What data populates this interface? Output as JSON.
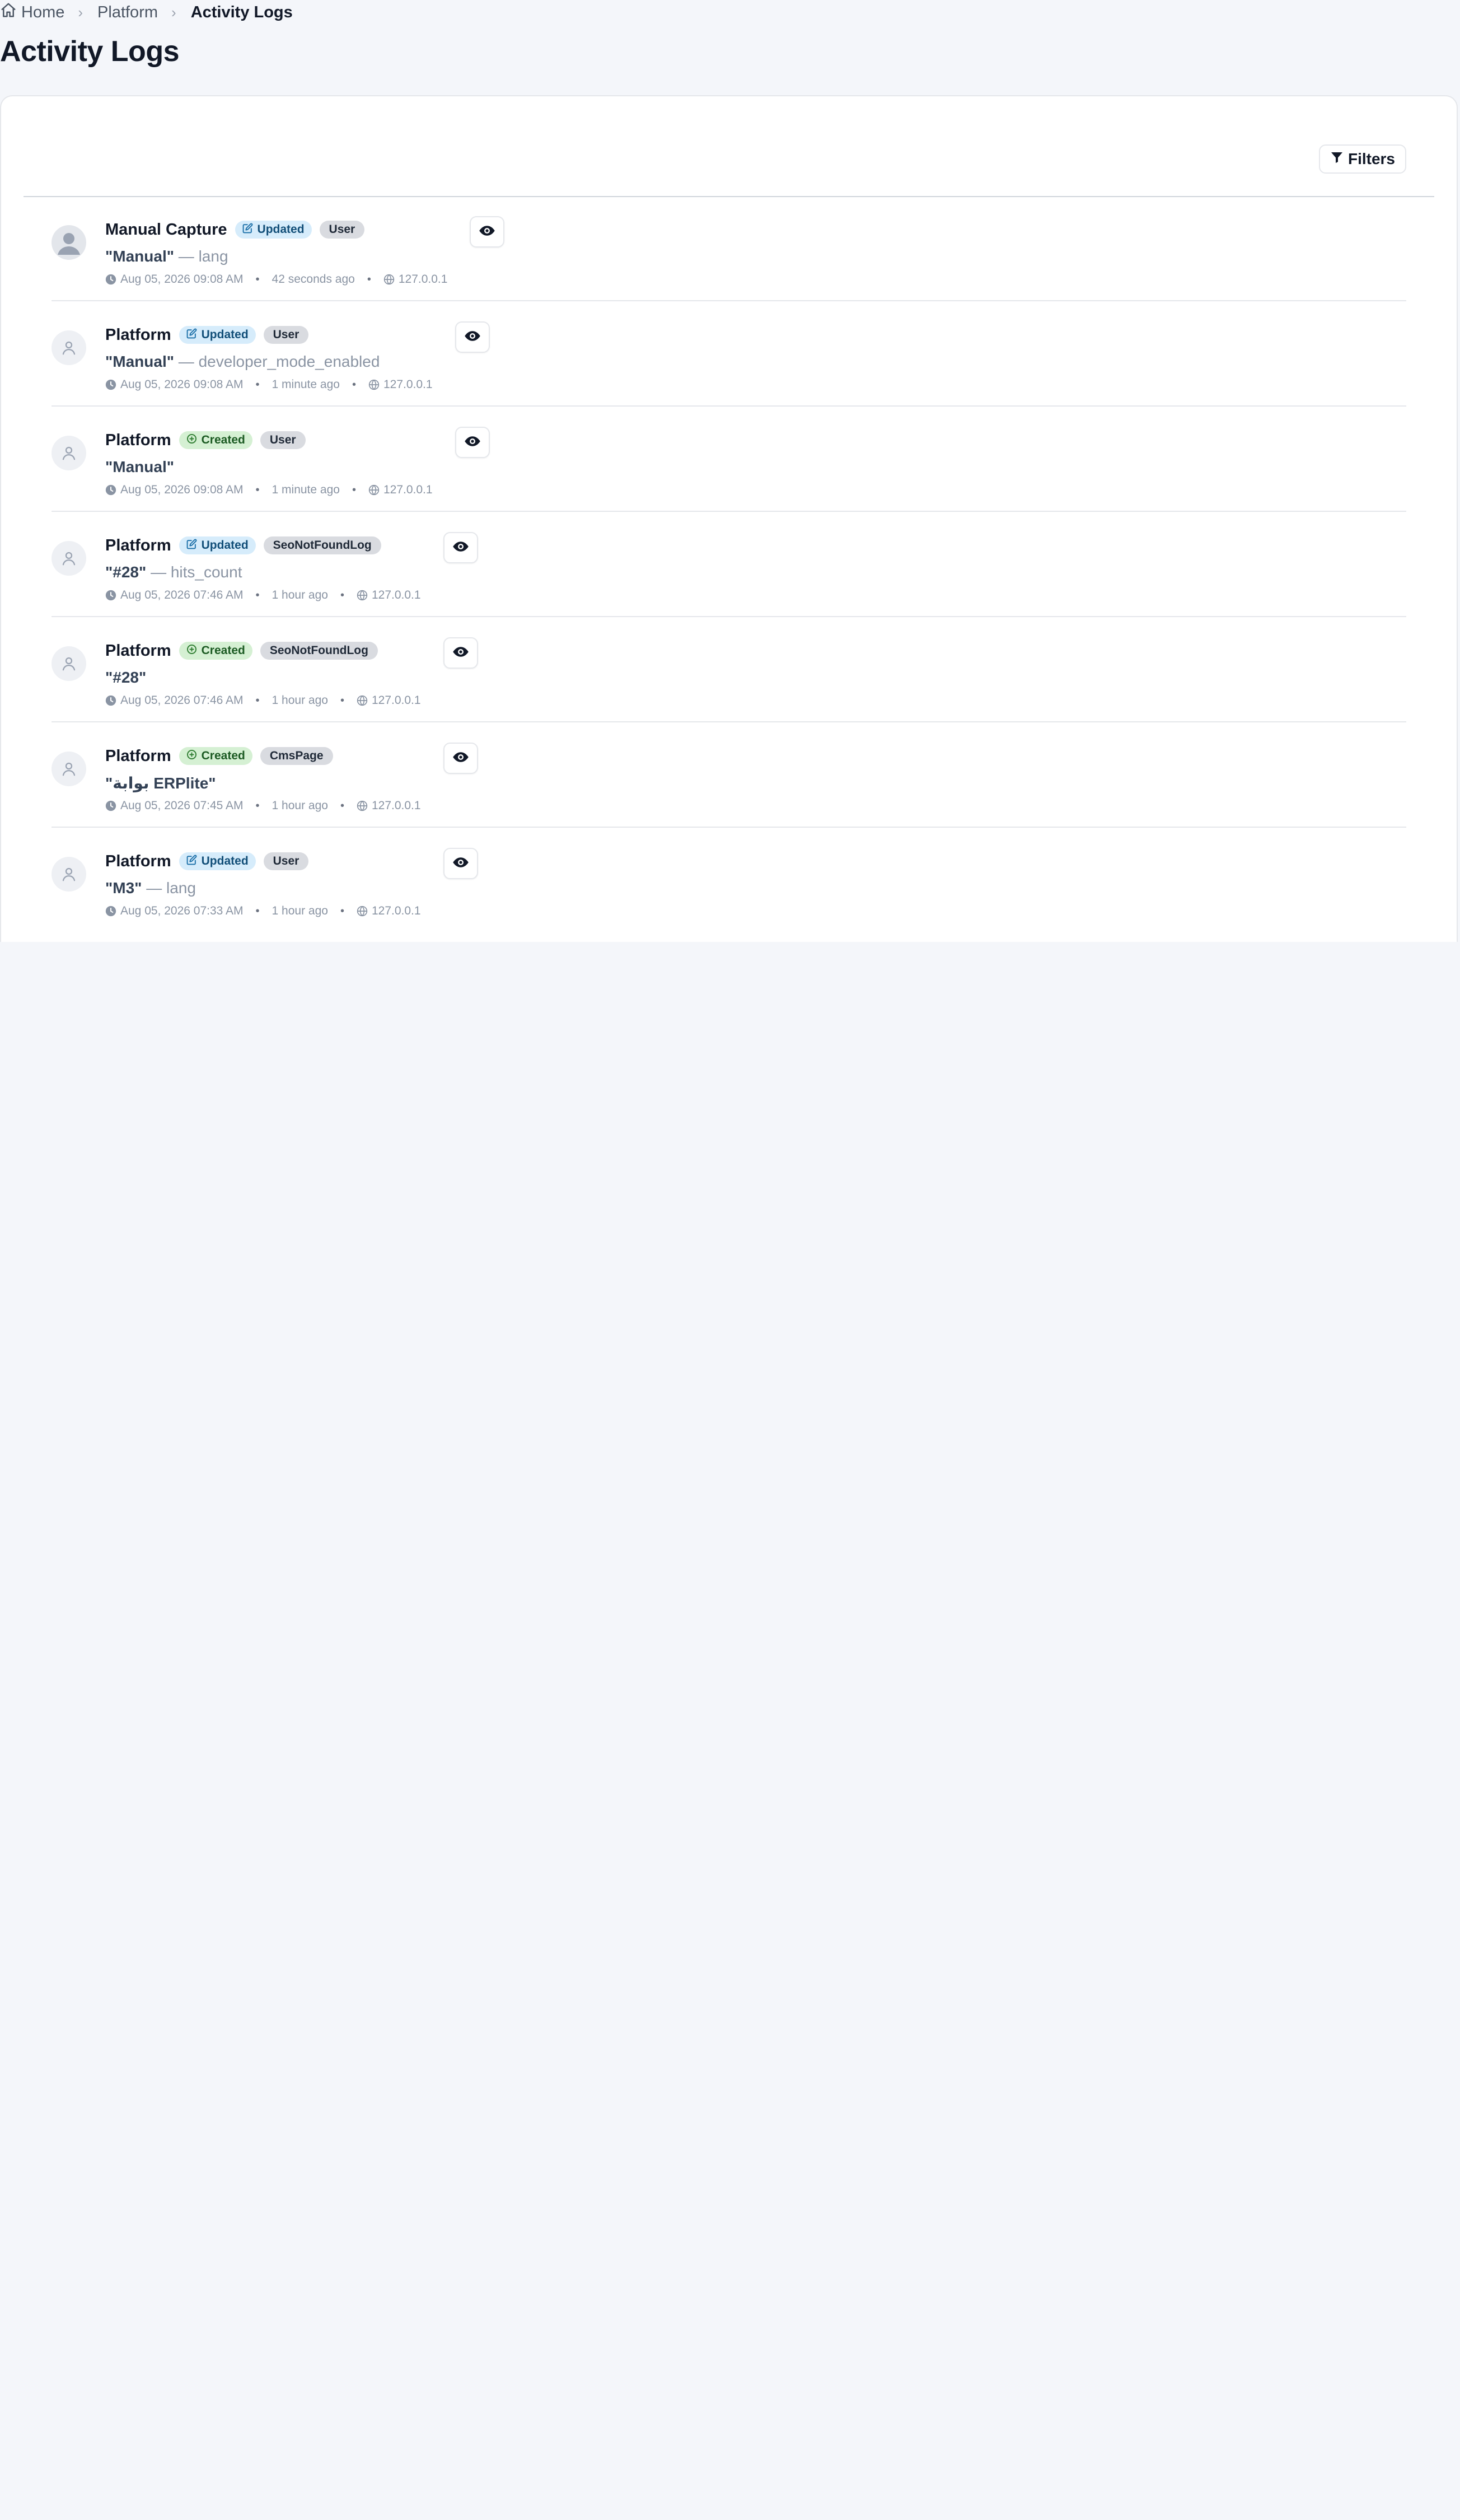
{
  "breadcrumb": {
    "home": "Home",
    "section": "Platform",
    "current": "Activity Logs"
  },
  "page": {
    "title": "Activity Logs"
  },
  "toolbar": {
    "filters_label": "Filters"
  },
  "logs": [
    {
      "actor": "Manual Capture",
      "event": "Updated",
      "model": "User",
      "subject": "\"Manual\"",
      "changes": "— lang",
      "date": "Aug 05, 2026 09:08 AM",
      "ago": "42 seconds ago",
      "ip": "127.0.0.1"
    },
    {
      "actor": "Platform",
      "event": "Updated",
      "model": "User",
      "subject": "\"Manual\"",
      "changes": "— developer_mode_enabled",
      "date": "Aug 05, 2026 09:08 AM",
      "ago": "1 minute ago",
      "ip": "127.0.0.1"
    },
    {
      "actor": "Platform",
      "event": "Created",
      "model": "User",
      "subject": "\"Manual\"",
      "changes": "",
      "date": "Aug 05, 2026 09:08 AM",
      "ago": "1 minute ago",
      "ip": "127.0.0.1"
    },
    {
      "actor": "Platform",
      "event": "Updated",
      "model": "SeoNotFoundLog",
      "subject": "\"#28\"",
      "changes": "— hits_count",
      "date": "Aug 05, 2026 07:46 AM",
      "ago": "1 hour ago",
      "ip": "127.0.0.1"
    },
    {
      "actor": "Platform",
      "event": "Created",
      "model": "SeoNotFoundLog",
      "subject": "\"#28\"",
      "changes": "",
      "date": "Aug 05, 2026 07:46 AM",
      "ago": "1 hour ago",
      "ip": "127.0.0.1"
    },
    {
      "actor": "Platform",
      "event": "Created",
      "model": "CmsPage",
      "subject": "\"بوابة ERPlite\"",
      "changes": "",
      "date": "Aug 05, 2026 07:45 AM",
      "ago": "1 hour ago",
      "ip": "127.0.0.1"
    },
    {
      "actor": "Platform",
      "event": "Updated",
      "model": "User",
      "subject": "\"M3\"",
      "changes": "— lang",
      "date": "Aug 05, 2026 07:33 AM",
      "ago": "1 hour ago",
      "ip": "127.0.0.1"
    }
  ],
  "icons": {
    "home": "home-icon",
    "chevron": "chevron-right-icon",
    "filter": "filter-icon",
    "avatar_photo": "user-photo-icon",
    "avatar": "user-icon",
    "updated": "edit-icon",
    "created": "plus-circle-icon",
    "clock": "clock-icon",
    "globe": "globe-icon",
    "view": "eye-icon"
  },
  "colors": {
    "page_bg": "#f4f6fa",
    "updated_badge_bg": "#d6ecfb",
    "updated_badge_fg": "#114e78",
    "created_badge_bg": "#d5f0d3",
    "created_badge_fg": "#1b5a22",
    "model_badge_bg": "#d9dbe0",
    "meta_text": "#8a94a3"
  }
}
